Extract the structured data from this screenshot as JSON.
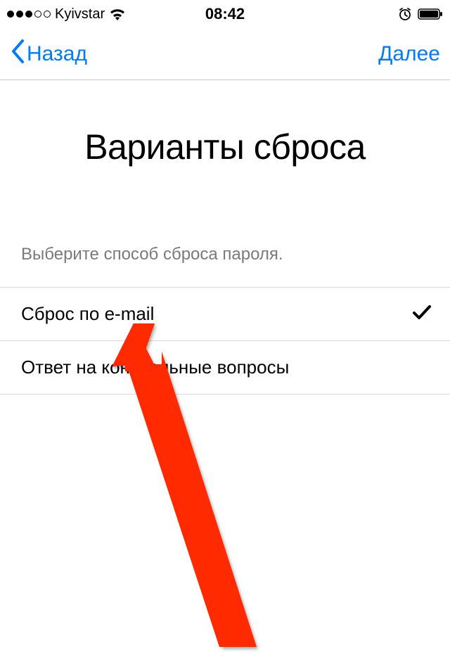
{
  "status_bar": {
    "carrier": "Kyivstar",
    "time": "08:42"
  },
  "nav": {
    "back_label": "Назад",
    "next_label": "Далее"
  },
  "page": {
    "title": "Варианты сброса",
    "description": "Выберите способ сброса пароля."
  },
  "options": [
    {
      "label": "Сброс по e-mail",
      "selected": true
    },
    {
      "label": "Ответ на контрольные вопросы",
      "selected": false
    }
  ]
}
